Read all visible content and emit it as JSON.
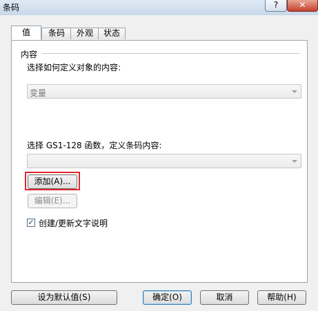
{
  "window": {
    "title": "条码",
    "help_label": "?",
    "close_label": "✕"
  },
  "tabs": [
    {
      "label": "值"
    },
    {
      "label": "条码"
    },
    {
      "label": "外观"
    },
    {
      "label": "状态"
    }
  ],
  "content": {
    "group_label": "内容",
    "define_prompt": "选择如何定义对象的内容:",
    "define_combo_value": "变量",
    "gs1_prompt": "选择 GS1-128 函数，定义条码内容:",
    "gs1_combo_value": "",
    "add_button": "添加(A)...",
    "edit_button": "编辑(E)...",
    "checkbox_label": "创建/更新文字说明",
    "checkbox_checked": true
  },
  "footer": {
    "set_default": "设为默认值(S)",
    "ok": "确定(O)",
    "cancel": "取消",
    "help": "帮助(H)"
  },
  "colors": {
    "highlight": "#e0262d",
    "close_button": "#c5402a"
  }
}
